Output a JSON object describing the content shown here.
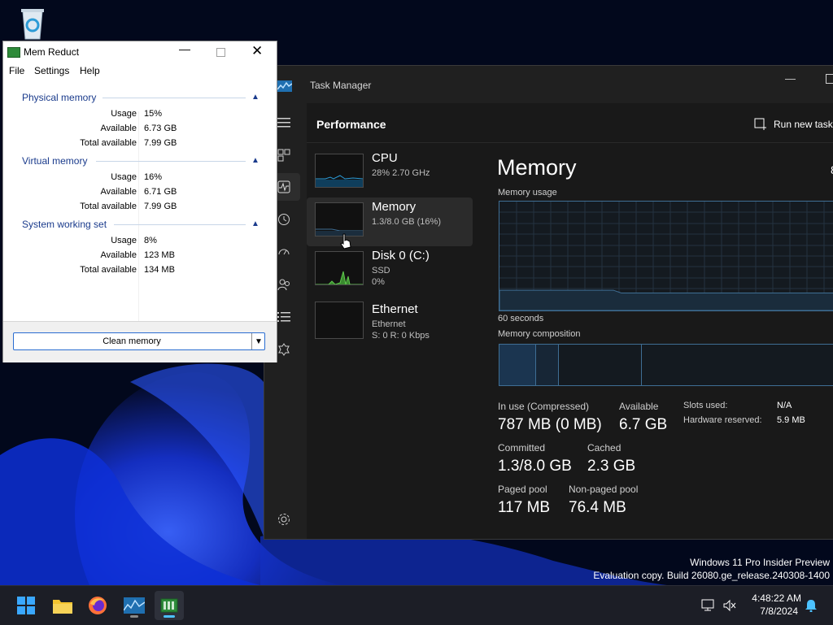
{
  "desktop": {
    "recycle_icon": "recycle-bin-icon",
    "watermark_line1": "Windows 11 Pro Insider Preview",
    "watermark_line2": "Evaluation copy. Build 26080.ge_release.240308-1400"
  },
  "task_manager": {
    "title": "Task Manager",
    "page_title": "Performance",
    "run_new_task": "Run new task",
    "resources": [
      {
        "name": "CPU",
        "sub1": "28%  2.70 GHz",
        "sub2": ""
      },
      {
        "name": "Memory",
        "sub1": "1.3/8.0 GB (16%)",
        "sub2": ""
      },
      {
        "name": "Disk 0 (C:)",
        "sub1": "SSD",
        "sub2": "0%"
      },
      {
        "name": "Ethernet",
        "sub1": "Ethernet",
        "sub2": "S: 0 R: 0 Kbps"
      }
    ],
    "detail": {
      "title": "Memory",
      "title_right": "8",
      "usage_label": "Memory usage",
      "seconds_label": "60 seconds",
      "composition_label": "Memory composition",
      "usage_fraction": 0.16,
      "stats": {
        "in_use_label": "In use (Compressed)",
        "in_use_value": "787 MB (0 MB)",
        "available_label": "Available",
        "available_value": "6.7 GB",
        "committed_label": "Committed",
        "committed_value": "1.3/8.0 GB",
        "cached_label": "Cached",
        "cached_value": "2.3 GB",
        "paged_label": "Paged pool",
        "paged_value": "117 MB",
        "nonpaged_label": "Non-paged pool",
        "nonpaged_value": "76.4 MB",
        "slots_label": "Slots used:",
        "slots_value": "N/A",
        "hw_label": "Hardware reserved:",
        "hw_value": "5.9 MB"
      }
    },
    "accent_color": "#3f6e94"
  },
  "mem_reduct": {
    "title": "Mem Reduct",
    "menu": {
      "file": "File",
      "settings": "Settings",
      "help": "Help"
    },
    "sections": [
      {
        "title": "Physical memory",
        "usage": "15%",
        "available": "6.73 GB",
        "total": "7.99 GB"
      },
      {
        "title": "Virtual memory",
        "usage": "16%",
        "available": "6.71 GB",
        "total": "7.99 GB"
      },
      {
        "title": "System working set",
        "usage": "8%",
        "available": "123 MB",
        "total": "134 MB"
      }
    ],
    "row_labels": {
      "usage": "Usage",
      "available": "Available",
      "total": "Total available"
    },
    "clean_button": "Clean memory",
    "accent_color": "#1a3b8c"
  },
  "taskbar": {
    "time": "4:48:22 AM",
    "date": "7/8/2024",
    "apps": [
      "start-icon",
      "file-explorer-icon",
      "firefox-icon",
      "task-manager-icon",
      "mem-reduct-icon"
    ]
  }
}
